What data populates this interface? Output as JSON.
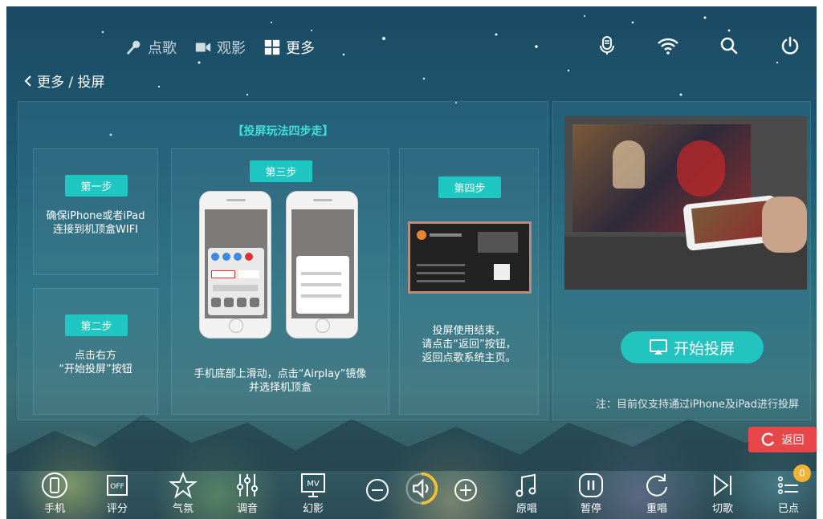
{
  "nav": {
    "items": [
      {
        "label": "点歌",
        "icon": "microphone-icon",
        "active": false
      },
      {
        "label": "观影",
        "icon": "video-camera-icon",
        "active": false
      },
      {
        "label": "更多",
        "icon": "grid-icon",
        "active": true
      }
    ]
  },
  "top_icons": [
    "microphone-icon",
    "wifi-icon",
    "search-icon",
    "power-icon"
  ],
  "breadcrumb": {
    "text": "更多 / 投屏"
  },
  "panel": {
    "title": "【投屏玩法四步走】",
    "step1": {
      "badge": "第一步",
      "text_line1": "确保iPhone或者iPad",
      "text_line2": "连接到机顶盒WIFI"
    },
    "step2": {
      "badge": "第二步",
      "text_line1": "点击右方",
      "text_line2": "“开始投屏”按钮"
    },
    "step3": {
      "badge": "第三步",
      "text_line1": "手机底部上滑动，点击“Airplay”镜像",
      "text_line2": "并选择机顶盒"
    },
    "step4": {
      "badge": "第四步",
      "text_line1": "投屏使用结束，",
      "text_line2": "请点击“返回”按钮，",
      "text_line3": "返回点歌系统主页。"
    }
  },
  "right": {
    "start_button": "开始投屏",
    "note": "注：目前仅支持通过iPhone及iPad进行投屏"
  },
  "back_button": "返回",
  "toolbar": {
    "items": [
      {
        "label": "手机",
        "icon": "phone-icon"
      },
      {
        "label": "评分",
        "icon": "score-off-icon",
        "badge_text": "OFF"
      },
      {
        "label": "气氛",
        "icon": "star-icon"
      },
      {
        "label": "调音",
        "icon": "equalizer-icon"
      },
      {
        "label": "幻影",
        "icon": "mv-icon",
        "badge_text": "MV"
      },
      {
        "label": "原唱",
        "icon": "music-note-icon"
      },
      {
        "label": "暂停",
        "icon": "pause-icon"
      },
      {
        "label": "重唱",
        "icon": "replay-icon"
      },
      {
        "label": "切歌",
        "icon": "skip-icon"
      },
      {
        "label": "已点",
        "icon": "playlist-icon",
        "count": "0"
      }
    ]
  },
  "colors": {
    "accent": "#23c3c0",
    "danger": "#e8474a",
    "badge": "#f2b233",
    "title": "#3fe0d6"
  }
}
